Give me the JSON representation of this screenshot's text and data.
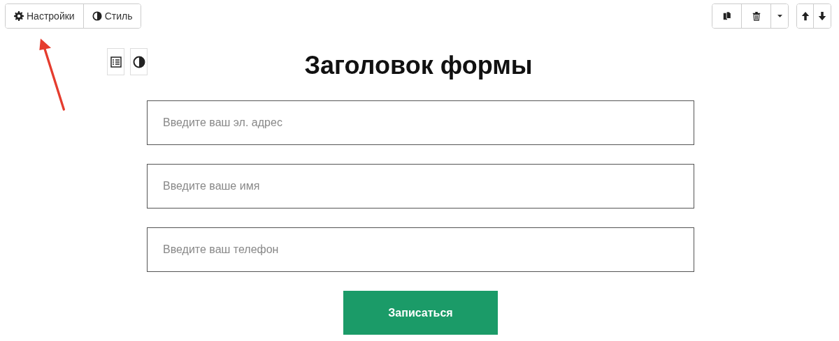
{
  "toolbar": {
    "buttons": [
      {
        "label": "Настройки",
        "kind": "settings"
      },
      {
        "label": "Стиль",
        "kind": "style"
      }
    ]
  },
  "form": {
    "title": "Заголовок формы",
    "fields": [
      {
        "placeholder": "Введите ваш эл. адрес"
      },
      {
        "placeholder": "Введите ваше имя"
      },
      {
        "placeholder": "Введите ваш телефон"
      }
    ],
    "submit": {
      "label": "Записаться"
    }
  }
}
